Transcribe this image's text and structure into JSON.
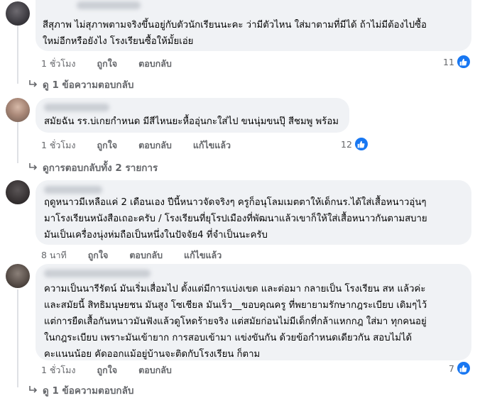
{
  "comments": [
    {
      "text": "สีสุภาพ ไม่สุภาพตามจริงขึ้นอยู่กับตัวนักเรียนนะคะ ว่ามีตัวไหน ใส่มาตามที่มีได้ ถ้าไม่มีต้องไปซื้อ\nใหม่อีกหรือยังไง โรงเรียนซื้อให้มั้ยเอ่ย",
      "time": "1 ชั่วโมง",
      "like_label": "ถูกใจ",
      "reply_label": "ตอบกลับ",
      "reactions": "11",
      "replies": "ดู 1 ข้อความตอบกลับ"
    },
    {
      "text": "สมัยฉัน รร.บ่เกยกำหนด มีสีไหนยะหื้ออุ่นกะใส่ไป ขนนุ่มขนปุ๊ สีชมพู พร้อม",
      "time": "1 ชั่วโมง",
      "like_label": "ถูกใจ",
      "reply_label": "ตอบกลับ",
      "edited_label": "แก้ไขแล้ว",
      "reactions": "12",
      "replies": "ดูการตอบกลับทั้ง 2 รายการ"
    },
    {
      "text": "ฤดูหนาวมีเหลือแค่ 2 เดือนเอง ปีนี้หนาวจัดจริงๆ ครูก็อนุโลมเมตตาให้เด็กนร.ได้ใส่เสื้อหนาวอุ่นๆ\nมาโรงเรียนหนังสือเถอะครับ / โรงเรียนที่ยุโรปเมืองที่พัฒนาแล้วเขาก็ให้ใส่เสื้อหนาวกันตามสบาย\nมันเป็นเครื่องนุ่งห่มถือเป็นหนึ่งในปัจจัย4 ที่จำเป็นนะครับ",
      "time": "8 นาที",
      "like_label": "ถูกใจ",
      "reply_label": "ตอบกลับ",
      "edited_label": "แก้ไขแล้ว"
    },
    {
      "text": "ความเป็นนารีรัตน์ มันเริ่มเสื่อมไป ตั้งแต่มีการแบ่งเขต และต่อมา กลายเป็น โรงเรียน สห แล้วค่ะ\nและสมัยนี้ สิทธิมนุษยชน มันสูง โซเชียล มันเร็ว__ขอบคุณครู ที่พยายามรักษากฎระเบียบ เดิมๆไว้\nแต่การยืดเสื้อกันหนาวมันฟังแล้วดูโหดร้ายจริง แต่สมัยก่อนไม่มีเด็กที่กล้าแหกกฎ ใส่มา ทุกคนอยู่\nในกฎระเบียบ เพราะมันเข้ายาก การสอบเข้ามา แข่งขันกัน ด้วยข้อกำหนดเดียวกัน สอบไม่ได้\nคะแนนน้อย คัดออกแม้อยู่บ้านจะติดกับโรงเรียน ก็ตาม",
      "time": "1 ชั่วโมง",
      "like_label": "ถูกใจ",
      "reply_label": "ตอบกลับ",
      "reactions": "7",
      "replies": "ดู 1 ข้อความตอบกลับ"
    }
  ],
  "colors": {
    "bubble": "#f0f2f5",
    "meta_text": "#65676b",
    "like_blue": "#1877f2"
  }
}
